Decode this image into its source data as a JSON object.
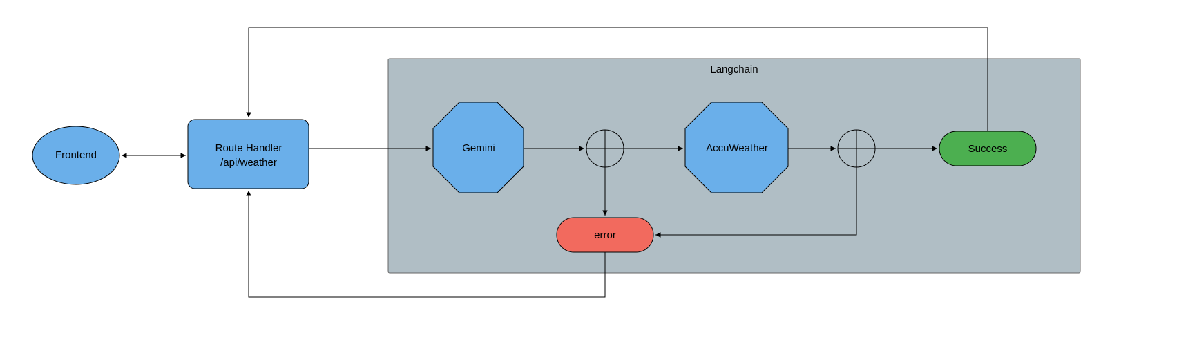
{
  "nodes": {
    "frontend": {
      "label": "Frontend",
      "shape": "ellipse",
      "fill": "#6AAFEA",
      "stroke": "#000000"
    },
    "route_handler": {
      "label1": "Route Handler",
      "label2": "/api/weather",
      "shape": "rounded-rect",
      "fill": "#6AAFEA",
      "stroke": "#000000"
    },
    "gemini": {
      "label": "Gemini",
      "shape": "octagon",
      "fill": "#6AAFEA",
      "stroke": "#000000"
    },
    "accuweather": {
      "label": "AccuWeather",
      "shape": "octagon",
      "fill": "#6AAFEA",
      "stroke": "#000000"
    },
    "success": {
      "label": "Success",
      "shape": "rounded-rect",
      "fill": "#4CAF50",
      "stroke": "#000000"
    },
    "error": {
      "label": "error",
      "shape": "rounded-rect",
      "fill": "#F26A5E",
      "stroke": "#000000"
    },
    "branch1": {
      "shape": "sum-junction"
    },
    "branch2": {
      "shape": "sum-junction"
    }
  },
  "group": {
    "label": "Langchain",
    "fill": "#B0BEC5",
    "stroke": "#666666"
  },
  "edges": [
    {
      "from": "frontend",
      "to": "route_handler",
      "bidirectional": true
    },
    {
      "from": "route_handler",
      "to": "gemini"
    },
    {
      "from": "gemini",
      "to": "branch1"
    },
    {
      "from": "branch1",
      "to": "accuweather"
    },
    {
      "from": "accuweather",
      "to": "branch2"
    },
    {
      "from": "branch2",
      "to": "success"
    },
    {
      "from": "branch1",
      "to": "error"
    },
    {
      "from": "branch2",
      "to": "error"
    },
    {
      "from": "error",
      "to": "route_handler"
    },
    {
      "from": "success",
      "to": "route_handler"
    }
  ],
  "colors": {
    "arrow": "#000000"
  }
}
